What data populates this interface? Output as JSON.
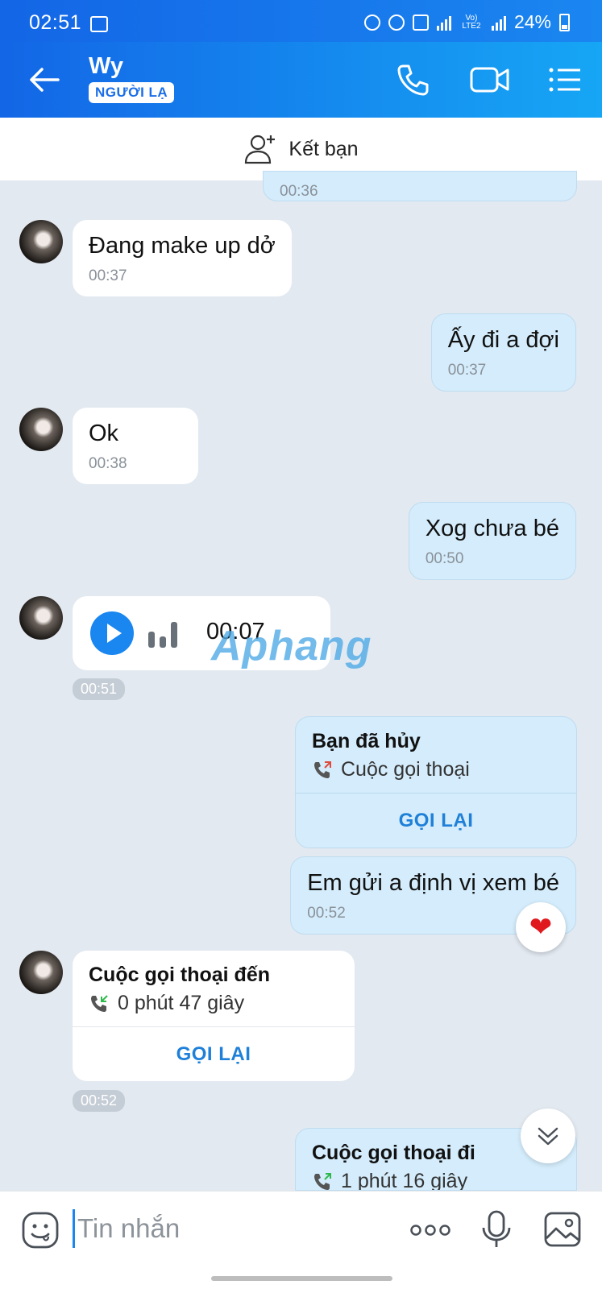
{
  "status_bar": {
    "time": "02:51",
    "network": "Vo) LTE2",
    "battery": "24%"
  },
  "header": {
    "contact_name": "Wy",
    "badge": "NGƯỜI LẠ"
  },
  "add_friend": {
    "label": "Kết bạn"
  },
  "messages": {
    "m0_time": "00:36",
    "m1": {
      "text": "Đang make up dở",
      "time": "00:37"
    },
    "m2": {
      "text": "Ấy đi a đợi",
      "time": "00:37"
    },
    "m3": {
      "text": "Ok",
      "time": "00:38"
    },
    "m4": {
      "text": "Xog chưa bé",
      "time": "00:50"
    },
    "voice": {
      "duration": "00:07",
      "time": "00:51"
    },
    "call1": {
      "title": "Bạn đã hủy",
      "subtitle": "Cuộc gọi thoại",
      "action": "GỌI LẠI"
    },
    "m5": {
      "text": "Em gửi a định vị xem bé",
      "time": "00:52"
    },
    "call2": {
      "title": "Cuộc gọi thoại đến",
      "subtitle": "0 phút 47 giây",
      "action": "GỌI LẠI",
      "time": "00:52"
    },
    "call3": {
      "title": "Cuộc gọi thoại đi",
      "subtitle": "1 phút 16 giây"
    }
  },
  "watermark": {
    "text": "Aphang"
  },
  "input": {
    "placeholder": "Tin nhắn"
  },
  "colors": {
    "primary": "#1a86f0",
    "outgoing_bubble": "#d4ecfb",
    "background": "#e2e9f1",
    "heart": "#e0191f"
  }
}
